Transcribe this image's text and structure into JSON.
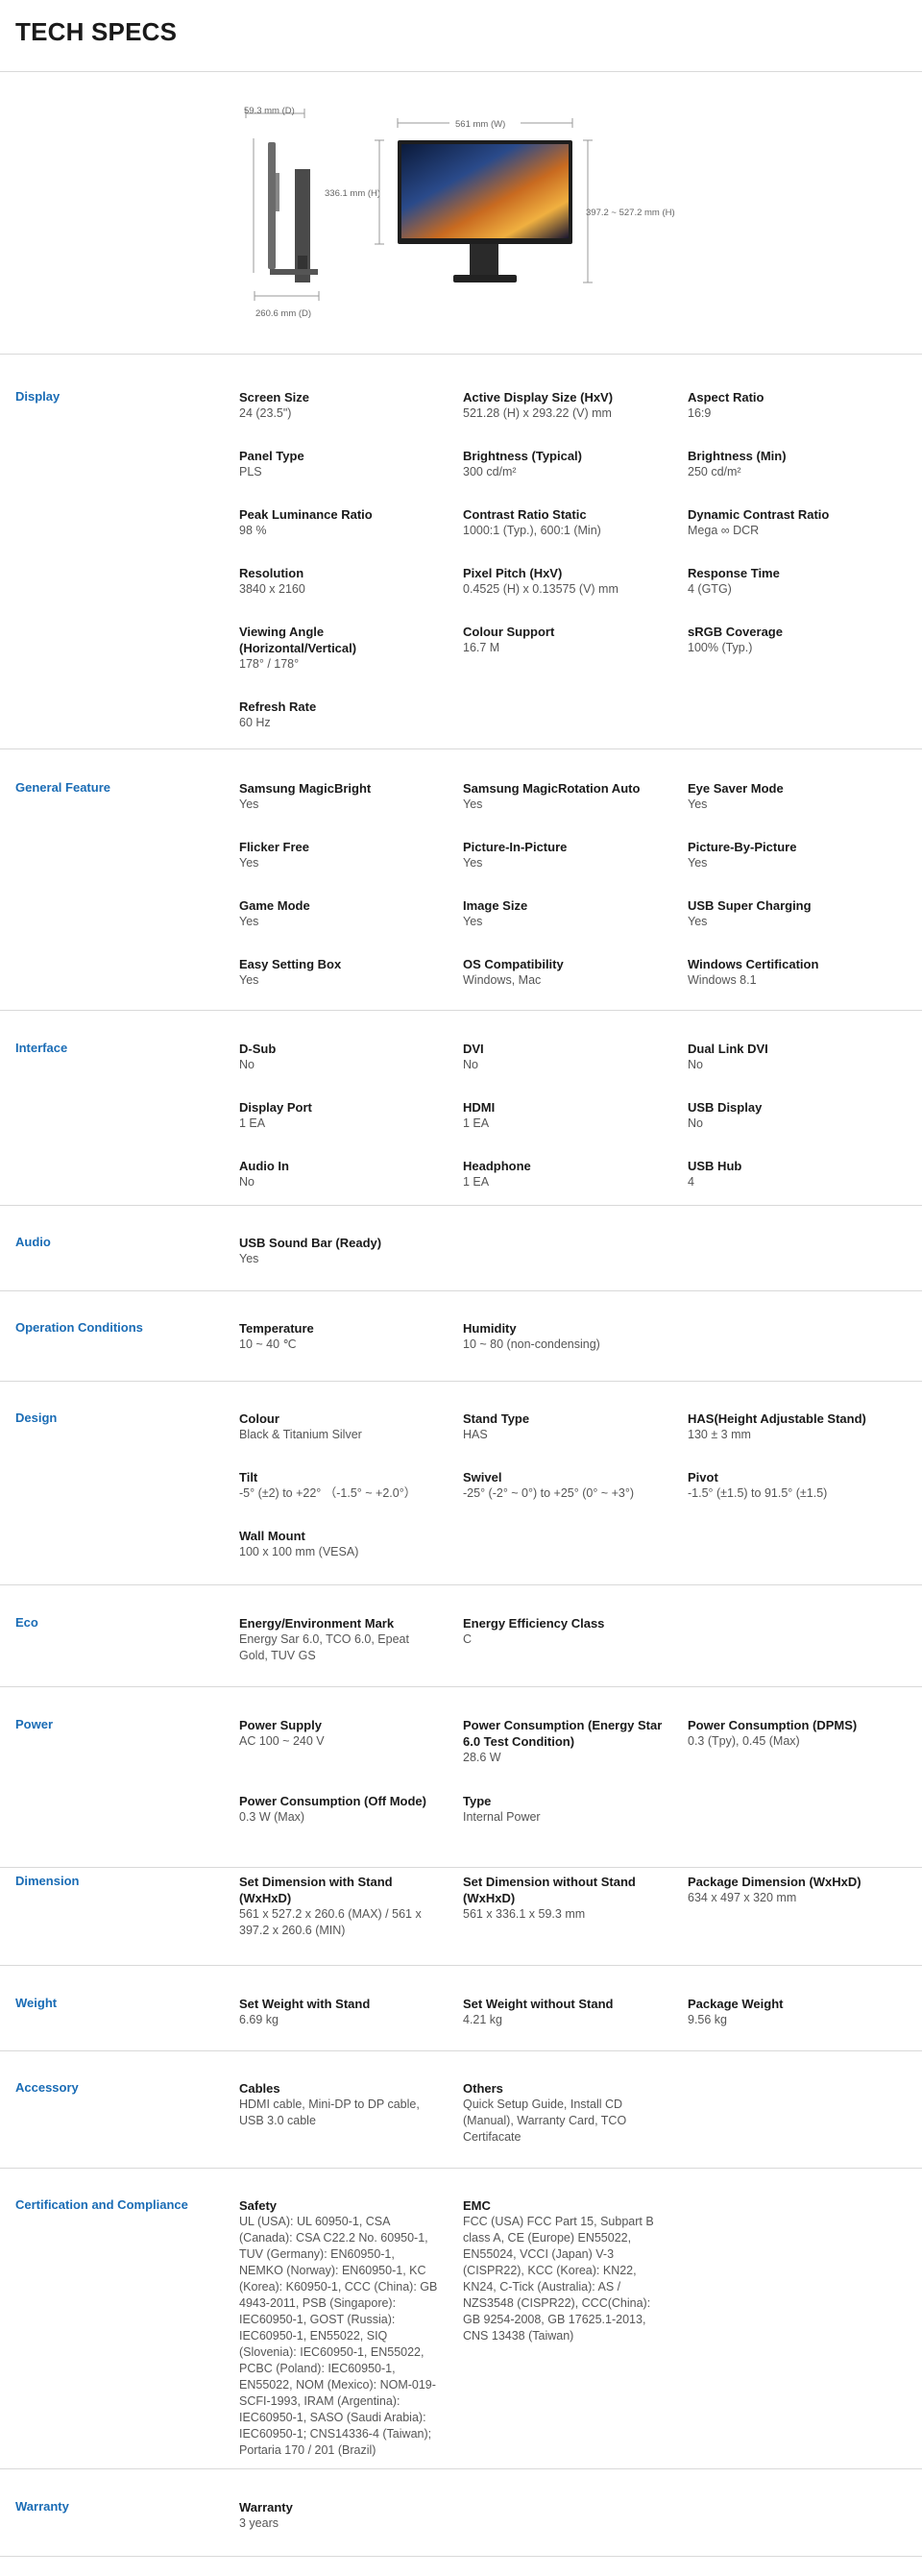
{
  "page_title": "TECH SPECS",
  "hero": {
    "depth_top": "59.3 mm (D)",
    "height_side": "336.1 mm (H)",
    "depth_bottom": "260.6 mm (D)",
    "width_top": "561 mm (W)",
    "height_range": "397.2 ~ 527.2 mm (H)"
  },
  "sections": [
    {
      "label": "Display",
      "items": [
        {
          "label": "Screen Size",
          "value": "24 (23.5\")"
        },
        {
          "label": "Active Display Size (HxV)",
          "value": "521.28 (H) x 293.22 (V) mm"
        },
        {
          "label": "Aspect Ratio",
          "value": "16:9"
        },
        {
          "label": "Panel Type",
          "value": "PLS"
        },
        {
          "label": "Brightness (Typical)",
          "value": "300 cd/m²"
        },
        {
          "label": "Brightness (Min)",
          "value": "250 cd/m²"
        },
        {
          "label": "Peak Luminance Ratio",
          "value": "98 %"
        },
        {
          "label": "Contrast Ratio Static",
          "value": "1000:1 (Typ.), 600:1 (Min)"
        },
        {
          "label": "Dynamic Contrast Ratio",
          "value": "Mega ∞ DCR"
        },
        {
          "label": "Resolution",
          "value": "3840 x 2160"
        },
        {
          "label": "Pixel Pitch (HxV)",
          "value": "0.4525 (H) x 0.13575 (V) mm"
        },
        {
          "label": "Response Time",
          "value": "4 (GTG)"
        },
        {
          "label": "Viewing Angle (Horizontal/Vertical)",
          "value": "178° / 178°"
        },
        {
          "label": "Colour Support",
          "value": "16.7 M"
        },
        {
          "label": "sRGB Coverage",
          "value": "100% (Typ.)"
        },
        {
          "label": "Refresh Rate",
          "value": "60 Hz"
        }
      ]
    },
    {
      "label": "General Feature",
      "items": [
        {
          "label": "Samsung MagicBright",
          "value": "Yes"
        },
        {
          "label": "Samsung MagicRotation Auto",
          "value": "Yes"
        },
        {
          "label": "Eye Saver Mode",
          "value": "Yes"
        },
        {
          "label": "Flicker Free",
          "value": "Yes"
        },
        {
          "label": "Picture-In-Picture",
          "value": "Yes"
        },
        {
          "label": "Picture-By-Picture",
          "value": "Yes"
        },
        {
          "label": "Game Mode",
          "value": "Yes"
        },
        {
          "label": "Image Size",
          "value": "Yes"
        },
        {
          "label": "USB Super Charging",
          "value": "Yes"
        },
        {
          "label": "Easy Setting Box",
          "value": "Yes"
        },
        {
          "label": "OS Compatibility",
          "value": "Windows, Mac"
        },
        {
          "label": "Windows Certification",
          "value": "Windows 8.1"
        }
      ]
    },
    {
      "label": "Interface",
      "items": [
        {
          "label": "D-Sub",
          "value": "No"
        },
        {
          "label": "DVI",
          "value": "No"
        },
        {
          "label": "Dual Link DVI",
          "value": "No"
        },
        {
          "label": "Display Port",
          "value": "1 EA"
        },
        {
          "label": "HDMI",
          "value": "1 EA"
        },
        {
          "label": "USB Display",
          "value": "No"
        },
        {
          "label": "Audio In",
          "value": "No"
        },
        {
          "label": "Headphone",
          "value": "1 EA"
        },
        {
          "label": "USB Hub",
          "value": "4"
        }
      ]
    },
    {
      "label": "Audio",
      "items": [
        {
          "label": "USB Sound Bar (Ready)",
          "value": "Yes"
        }
      ]
    },
    {
      "label": "Operation Conditions",
      "items": [
        {
          "label": "Temperature",
          "value": "10 ~ 40 ℃"
        },
        {
          "label": "Humidity",
          "value": "10 ~ 80 (non-condensing)"
        }
      ]
    },
    {
      "label": "Design",
      "items": [
        {
          "label": "Colour",
          "value": "Black & Titanium Silver"
        },
        {
          "label": "Stand Type",
          "value": "HAS"
        },
        {
          "label": "HAS(Height Adjustable Stand)",
          "value": "130 ± 3 mm"
        },
        {
          "label": "Tilt",
          "value": "-5° (±2) to +22° （-1.5° ~ +2.0°）"
        },
        {
          "label": "Swivel",
          "value": "-25° (-2° ~ 0°) to +25° (0° ~ +3°)"
        },
        {
          "label": "Pivot",
          "value": "-1.5° (±1.5) to 91.5° (±1.5)"
        },
        {
          "label": "Wall Mount",
          "value": "100 x 100 mm (VESA)"
        }
      ]
    },
    {
      "label": "Eco",
      "items": [
        {
          "label": "Energy/Environment Mark",
          "value": "Energy Sar 6.0, TCO 6.0, Epeat Gold, TUV GS"
        },
        {
          "label": "Energy Efficiency Class",
          "value": "C"
        }
      ]
    },
    {
      "label": "Power",
      "items": [
        {
          "label": "Power Supply",
          "value": "AC 100 ~ 240 V"
        },
        {
          "label": "Power Consumption (Energy Star 6.0 Test Condition)",
          "value": "28.6 W"
        },
        {
          "label": "Power Consumption (DPMS)",
          "value": "0.3 (Tpy), 0.45 (Max)"
        },
        {
          "label": "Power Consumption (Off Mode)",
          "value": "0.3 W (Max)"
        },
        {
          "label": "Type",
          "value": "Internal Power"
        }
      ]
    },
    {
      "label": "Dimension",
      "items": [
        {
          "label": "Set Dimension with Stand (WxHxD)",
          "value": "561 x 527.2 x 260.6 (MAX) / 561 x 397.2 x 260.6 (MIN)"
        },
        {
          "label": "Set Dimension without Stand (WxHxD)",
          "value": "561 x 336.1 x 59.3 mm"
        },
        {
          "label": "Package Dimension (WxHxD)",
          "value": "634 x 497 x 320 mm"
        }
      ]
    },
    {
      "label": "Weight",
      "items": [
        {
          "label": "Set Weight with Stand",
          "value": "6.69 kg"
        },
        {
          "label": "Set Weight without Stand",
          "value": "4.21 kg"
        },
        {
          "label": "Package Weight",
          "value": "9.56 kg"
        }
      ]
    },
    {
      "label": "Accessory",
      "items": [
        {
          "label": "Cables",
          "value": "HDMI cable, Mini-DP to DP cable, USB 3.0 cable"
        },
        {
          "label": "Others",
          "value": "Quick Setup Guide, Install CD (Manual), Warranty Card, TCO Certifacate"
        }
      ]
    },
    {
      "label": "Certification and Compliance",
      "items": [
        {
          "label": "Safety",
          "value": "UL (USA): UL 60950-1, CSA (Canada): CSA C22.2 No. 60950-1, TUV (Germany): EN60950-1, NEMKO (Norway): EN60950-1, KC (Korea): K60950-1, CCC (China): GB 4943-2011, PSB (Singapore): IEC60950-1, GOST (Russia): IEC60950-1, EN55022, SIQ (Slovenia): IEC60950-1, EN55022, PCBC (Poland): IEC60950-1, EN55022, NOM (Mexico): NOM-019-SCFI-1993, IRAM (Argentina): IEC60950-1, SASO (Saudi Arabia): IEC60950-1; CNS14336-4 (Taiwan); Portaria 170 / 201 (Brazil)"
        },
        {
          "label": "EMC",
          "value": "FCC (USA) FCC Part 15, Subpart B class A, CE (Europe) EN55022, EN55024, VCCI (Japan) V-3 (CISPR22), KCC (Korea): KN22, KN24, C-Tick (Australia): AS / NZS3548 (CISPR22), CCC(China): GB 9254-2008, GB 17625.1-2013, CNS 13438 (Taiwan)"
        }
      ]
    },
    {
      "label": "Warranty",
      "items": [
        {
          "label": "Warranty",
          "value": "3 years"
        }
      ]
    }
  ]
}
